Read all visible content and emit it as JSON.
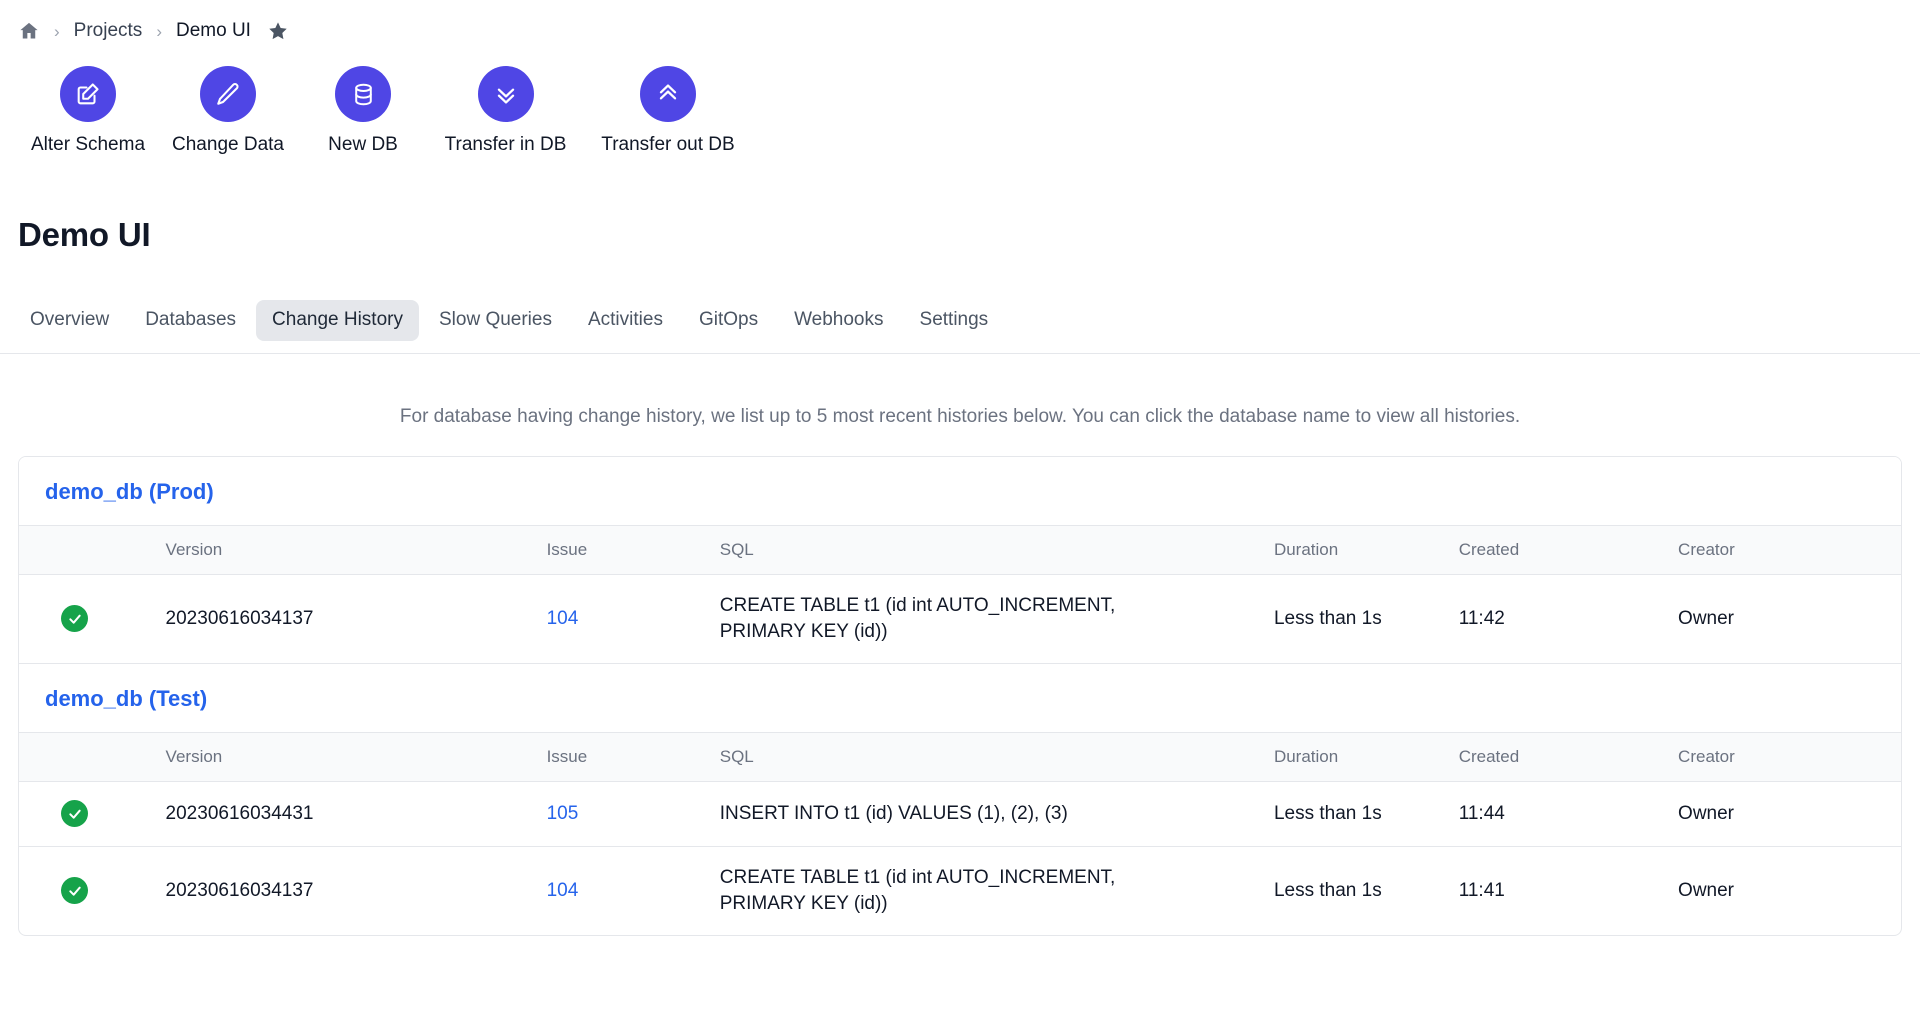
{
  "breadcrumb": {
    "home_icon": "home-icon",
    "separator": "›",
    "projects_label": "Projects",
    "current_label": "Demo UI",
    "star_icon": "star-icon"
  },
  "quick_actions": [
    {
      "label": "Alter Schema",
      "icon": "edit-square-icon"
    },
    {
      "label": "Change Data",
      "icon": "pencil-icon"
    },
    {
      "label": "New DB",
      "icon": "database-icon"
    },
    {
      "label": "Transfer in DB",
      "icon": "chevron-double-down-icon"
    },
    {
      "label": "Transfer out DB",
      "icon": "chevron-double-up-icon"
    }
  ],
  "page": {
    "title": "Demo UI",
    "description": "For database having change history, we list up to 5 most recent histories below. You can click the database name to view all histories."
  },
  "tabs": [
    {
      "label": "Overview",
      "active": false
    },
    {
      "label": "Databases",
      "active": false
    },
    {
      "label": "Change History",
      "active": true
    },
    {
      "label": "Slow Queries",
      "active": false
    },
    {
      "label": "Activities",
      "active": false
    },
    {
      "label": "GitOps",
      "active": false
    },
    {
      "label": "Webhooks",
      "active": false
    },
    {
      "label": "Settings",
      "active": false
    }
  ],
  "columns": [
    "Version",
    "Issue",
    "SQL",
    "Duration",
    "Created",
    "Creator"
  ],
  "sections": [
    {
      "db_name": "demo_db (Prod)",
      "rows": [
        {
          "status": "success",
          "version": "20230616034137",
          "issue": "104",
          "sql": "CREATE TABLE t1 (id int AUTO_INCREMENT,\nPRIMARY KEY (id))",
          "duration": "Less than 1s",
          "created": "11:42",
          "creator": "Owner"
        }
      ]
    },
    {
      "db_name": "demo_db (Test)",
      "rows": [
        {
          "status": "success",
          "version": "20230616034431",
          "issue": "105",
          "sql": "INSERT INTO t1 (id) VALUES (1), (2), (3)",
          "duration": "Less than 1s",
          "created": "11:44",
          "creator": "Owner"
        },
        {
          "status": "success",
          "version": "20230616034137",
          "issue": "104",
          "sql": "CREATE TABLE t1 (id int AUTO_INCREMENT,\nPRIMARY KEY (id))",
          "duration": "Less than 1s",
          "created": "11:41",
          "creator": "Owner"
        }
      ]
    }
  ],
  "colors": {
    "accent": "#4f46e5",
    "link": "#2563eb",
    "success": "#16a34a",
    "tab_active_bg": "#e5e7eb",
    "border": "#e5e7eb"
  }
}
